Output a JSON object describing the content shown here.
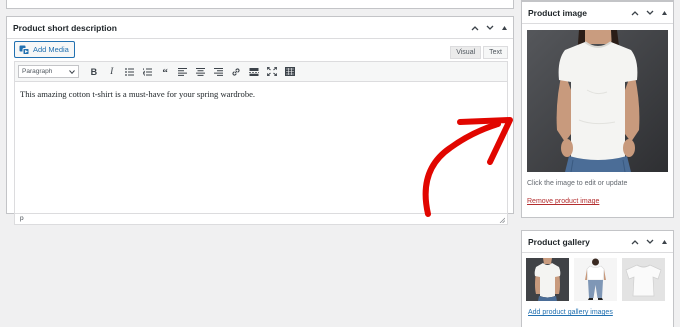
{
  "short_description": {
    "title": "Product short description",
    "add_media_label": "Add Media",
    "tabs": [
      "Visual",
      "Text"
    ],
    "format_select": "Paragraph",
    "content": "This amazing cotton t-shirt is a must-have for your spring wardrobe.",
    "status_path": "p",
    "toolbar_icons": [
      "bold-icon",
      "italic-icon",
      "bullet-list-icon",
      "numbered-list-icon",
      "blockquote-icon",
      "align-left-icon",
      "align-center-icon",
      "align-right-icon",
      "link-icon",
      "read-more-icon",
      "fullscreen-icon",
      "toolbar-toggle-icon"
    ]
  },
  "product_image": {
    "title": "Product image",
    "hint": "Click the image to edit or update",
    "remove_label": "Remove product image"
  },
  "gallery": {
    "title": "Product gallery",
    "add_label": "Add product gallery images",
    "thumbnails": [
      "tshirt-model-front",
      "tshirt-model-full",
      "tshirt-flat"
    ]
  },
  "colors": {
    "accent": "#2271b1",
    "danger": "#b32d2e",
    "annotation_arrow": "#e10600"
  }
}
